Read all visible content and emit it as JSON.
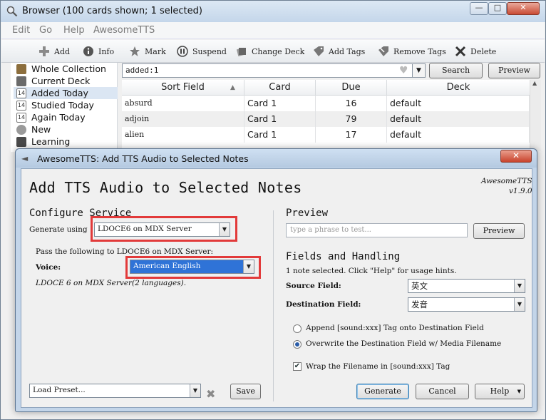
{
  "browser": {
    "title": "Browser (100 cards shown; 1 selected)",
    "menu": [
      "Edit",
      "Go",
      "Help",
      "AwesomeTTS"
    ],
    "toolbar": {
      "add": "Add",
      "info": "Info",
      "mark": "Mark",
      "suspend": "Suspend",
      "change_deck": "Change Deck",
      "add_tags": "Add Tags",
      "remove_tags": "Remove Tags",
      "delete": "Delete"
    },
    "sidebar": [
      {
        "label": "Whole Collection",
        "icon": "collection-icon"
      },
      {
        "label": "Current Deck",
        "icon": "deck-icon"
      },
      {
        "label": "Added Today",
        "icon": "calendar-icon",
        "cal": "14",
        "selected": true
      },
      {
        "label": "Studied Today",
        "icon": "calendar-icon",
        "cal": "14"
      },
      {
        "label": "Again Today",
        "icon": "calendar-icon",
        "cal": "14"
      },
      {
        "label": "New",
        "icon": "new-icon"
      },
      {
        "label": "Learning",
        "icon": "learning-icon"
      }
    ],
    "search": {
      "value": "added:1",
      "search_label": "Search",
      "preview_label": "Preview"
    },
    "table": {
      "headers": [
        "Sort Field",
        "Card",
        "Due",
        "Deck"
      ],
      "rows": [
        {
          "sort_field": "absurd",
          "card": "Card 1",
          "due": "16",
          "deck": "default"
        },
        {
          "sort_field": "adjoin",
          "card": "Card 1",
          "due": "79",
          "deck": "default"
        },
        {
          "sort_field": "alien",
          "card": "Card 1",
          "due": "17",
          "deck": "default"
        }
      ]
    }
  },
  "dialog": {
    "title": "AwesomeTTS: Add TTS Audio to Selected Notes",
    "heading": "Add TTS Audio to Selected Notes",
    "version_name": "AwesomeTTS",
    "version": "v1.9.0",
    "configure": {
      "heading": "Configure Service",
      "generate_using_label": "Generate using",
      "service": "LDOCE6 on MDX Server",
      "pass_label": "Pass the following to LDOCE6 on MDX Server:",
      "voice_label": "Voice:",
      "voice": "American English",
      "service_note": "LDOCE 6 on MDX Server(2 languages).",
      "load_preset": "Load Preset...",
      "save_label": "Save"
    },
    "preview": {
      "heading": "Preview",
      "placeholder": "type a phrase to test...",
      "button_label": "Preview"
    },
    "fields": {
      "heading": "Fields and Handling",
      "hint": "1 note selected. Click \"Help\" for usage hints.",
      "source_label": "Source Field:",
      "source_value": "英文",
      "destination_label": "Destination Field:",
      "destination_value": "发音",
      "append_label": "Append [sound:xxx] Tag onto Destination Field",
      "overwrite_label": "Overwrite the Destination Field w/ Media Filename",
      "wrap_label": "Wrap the Filename in [sound:xxx] Tag",
      "mode_selected": "overwrite",
      "wrap_checked": true
    },
    "buttons": {
      "generate": "Generate",
      "cancel": "Cancel",
      "help": "Help"
    }
  },
  "colors": {
    "highlight_box": "#e23a3a",
    "selection_blue": "#2f73d7",
    "dialog_frame": "#c3d5e9"
  }
}
